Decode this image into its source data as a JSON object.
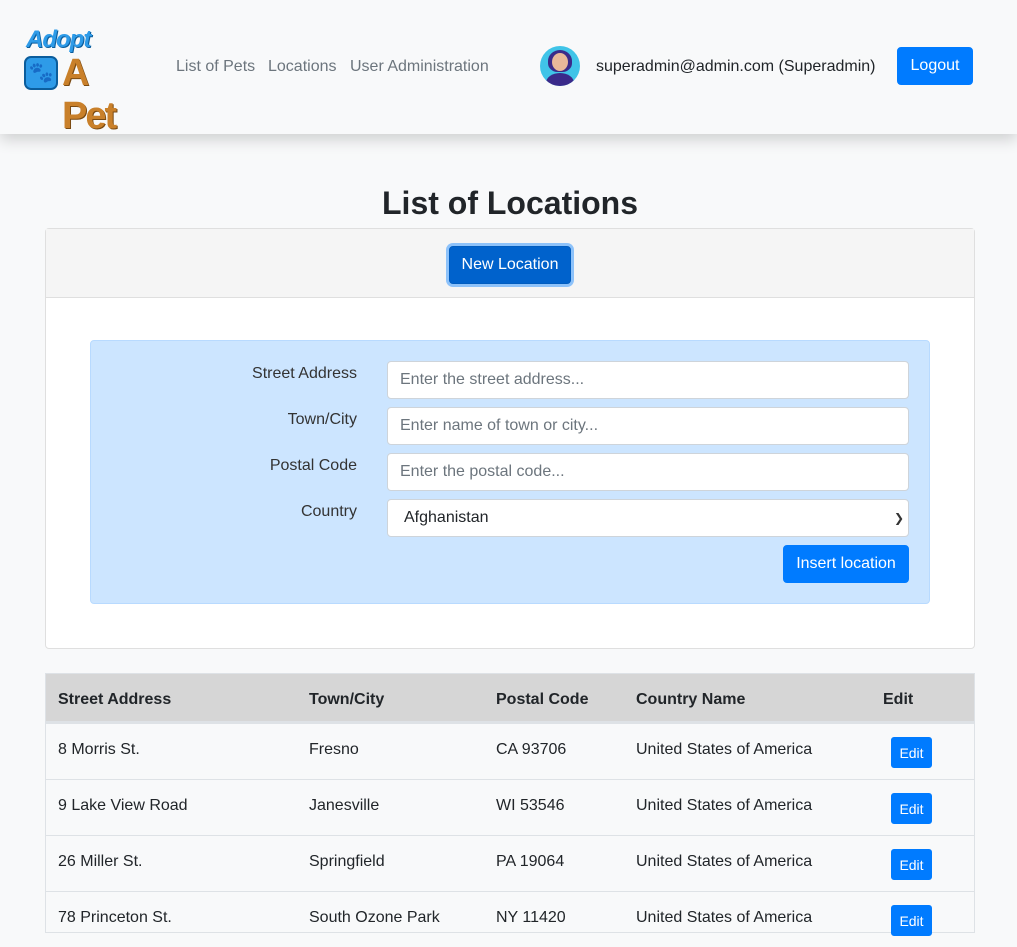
{
  "navbar": {
    "logo_line1": "Adopt",
    "logo_line2": "A Pet",
    "links": [
      "List of Pets",
      "Locations",
      "User Administration"
    ],
    "user": "superadmin@admin.com (Superadmin)",
    "logout_label": "Logout"
  },
  "page": {
    "title": "List of Locations",
    "new_location_label": "New Location"
  },
  "form": {
    "street_label": "Street Address",
    "street_placeholder": "Enter the street address...",
    "city_label": "Town/City",
    "city_placeholder": "Enter name of town or city...",
    "postal_label": "Postal Code",
    "postal_placeholder": "Enter the postal code...",
    "country_label": "Country",
    "country_selected": "Afghanistan",
    "insert_label": "Insert location"
  },
  "table": {
    "headers": [
      "Street Address",
      "Town/City",
      "Postal Code",
      "Country Name",
      "Edit"
    ],
    "rows": [
      [
        "8 Morris St.",
        "Fresno",
        "CA 93706",
        "United States of America"
      ],
      [
        "9 Lake View Road",
        "Janesville",
        "WI 53546",
        "United States of America"
      ],
      [
        "26 Miller St.",
        "Springfield",
        "PA 19064",
        "United States of America"
      ],
      [
        "78 Princeton St.",
        "South Ozone Park",
        "NY 11420",
        "United States of America"
      ]
    ],
    "edit_label": "Edit"
  },
  "colors": {
    "primary": "#007bff",
    "form_bg": "#cce5ff",
    "header_bg": "#d6d6d6"
  }
}
